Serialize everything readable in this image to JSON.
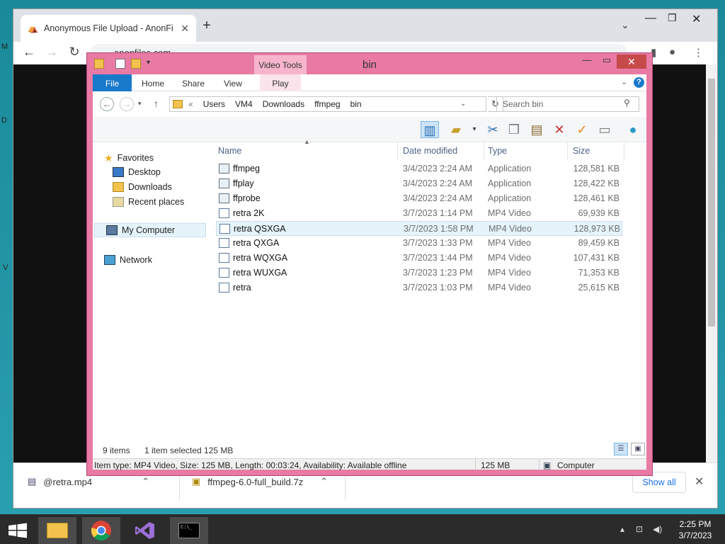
{
  "browser": {
    "tab_title": "Anonymous File Upload - AnonFi",
    "url": "anonfiles.com",
    "downloads": [
      {
        "name": "@retra.mp4"
      },
      {
        "name": "ffmpeg-6.0-full_build.7z"
      }
    ],
    "show_all_label": "Show all"
  },
  "explorer": {
    "title": "bin",
    "contextual_tab": "Video Tools",
    "ribbon_tabs": [
      "File",
      "Home",
      "Share",
      "View",
      "Play"
    ],
    "breadcrumb": [
      "Users",
      "VM4",
      "Downloads",
      "ffmpeg",
      "bin"
    ],
    "breadcrumb_prefix": "«",
    "search_placeholder": "Search bin",
    "nav": {
      "favorites": "Favorites",
      "desktop": "Desktop",
      "downloads": "Downloads",
      "recent": "Recent places",
      "computer": "My Computer",
      "network": "Network"
    },
    "columns": [
      "Name",
      "Date modified",
      "Type",
      "Size"
    ],
    "files": [
      {
        "name": "ffmpeg",
        "date": "3/4/2023 2:24 AM",
        "type": "Application",
        "size": "128,581 KB"
      },
      {
        "name": "ffplay",
        "date": "3/4/2023 2:24 AM",
        "type": "Application",
        "size": "128,422 KB"
      },
      {
        "name": "ffprobe",
        "date": "3/4/2023 2:24 AM",
        "type": "Application",
        "size": "128,461 KB"
      },
      {
        "name": "retra 2K",
        "date": "3/7/2023 1:14 PM",
        "type": "MP4 Video",
        "size": "69,939 KB"
      },
      {
        "name": "retra QSXGA",
        "date": "3/7/2023 1:58 PM",
        "type": "MP4 Video",
        "size": "128,973 KB"
      },
      {
        "name": "retra QXGA",
        "date": "3/7/2023 1:33 PM",
        "type": "MP4 Video",
        "size": "89,459 KB"
      },
      {
        "name": "retra WQXGA",
        "date": "3/7/2023 1:44 PM",
        "type": "MP4 Video",
        "size": "107,431 KB"
      },
      {
        "name": "retra WUXGA",
        "date": "3/7/2023 1:23 PM",
        "type": "MP4 Video",
        "size": "71,353 KB"
      },
      {
        "name": "retra",
        "date": "3/7/2023 1:03 PM",
        "type": "MP4 Video",
        "size": "25,615 KB"
      }
    ],
    "status": {
      "items": "9 items",
      "selected": "1 item selected  125 MB"
    },
    "details": {
      "info": "Item type: MP4 Video, Size: 125 MB, Length: 00:03:24, Availability: Available offline",
      "size": "125 MB",
      "location": "Computer"
    }
  },
  "taskbar": {
    "time": "2:25 PM",
    "date": "3/7/2023"
  },
  "desktop_letters": [
    "M",
    "D",
    "V"
  ],
  "colors": {
    "explorer_frame": "#e87aa4",
    "ribbon_file": "#1979ca",
    "selection": "#e5f3fb"
  }
}
